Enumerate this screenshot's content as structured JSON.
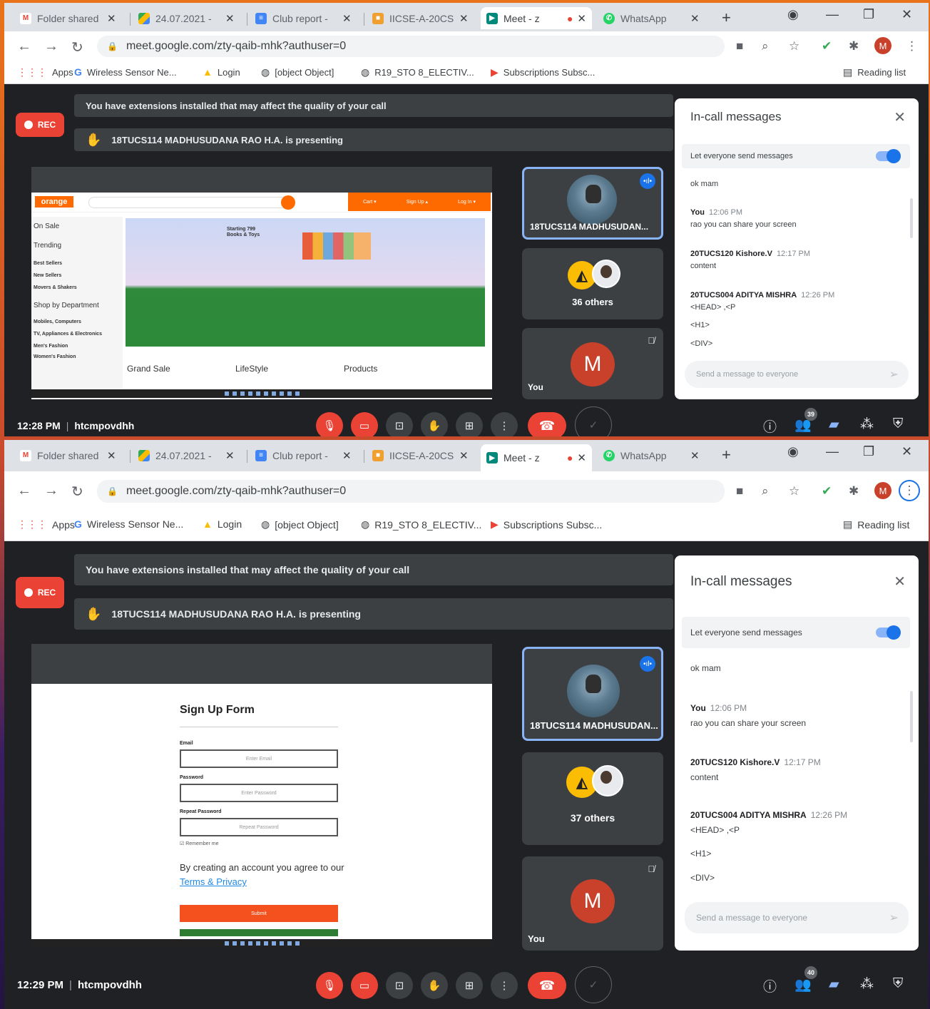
{
  "tabs": [
    {
      "label": "Folder shared",
      "icon": "gmail-icon"
    },
    {
      "label": "24.07.2021 -",
      "icon": "drive-icon"
    },
    {
      "label": "Club report -",
      "icon": "docs-icon"
    },
    {
      "label": "IICSE-A-20CS",
      "icon": "classroom-icon"
    },
    {
      "label": "Meet - z",
      "icon": "meet-icon"
    },
    {
      "label": "WhatsApp",
      "icon": "whatsapp-icon"
    }
  ],
  "url": "meet.google.com/zty-qaib-mhk?authuser=0",
  "bookmarks": [
    "Apps",
    "Wireless Sensor Ne...",
    "Login",
    "[object Object]",
    "R19_STO 8_ELECTIV...",
    "Subscriptions Subsc..."
  ],
  "reading_list": "Reading list",
  "profile_initial": "M",
  "meet": {
    "extension_warning": "You have extensions installed that may affect the quality of your call",
    "presenting": "18TUCS114 MADHUSUDANA RAO H.A. is presenting",
    "rec_label": "REC",
    "presenter_tile_name": "18TUCS114 MADHUSUDAN...",
    "you_label": "You",
    "you_initial": "M",
    "meeting_code": "htcmpovdhh"
  },
  "chat": {
    "title": "In-call messages",
    "toggle_label": "Let everyone send messages",
    "placeholder": "Send a message to everyone",
    "messages": [
      {
        "text": "ok mam"
      },
      {
        "sender": "You",
        "time": "12:06 PM",
        "text": "rao you can share your screen"
      },
      {
        "sender": "20TUCS120 Kishore.V",
        "time": "12:17 PM",
        "text": "content"
      },
      {
        "sender": "20TUCS004 ADITYA MISHRA",
        "time": "12:26 PM",
        "text": "<HEAD> ,<P"
      },
      {
        "text": "<H1>"
      },
      {
        "text": "<DIV>"
      }
    ]
  },
  "screen1": {
    "time": "12:28 PM",
    "others": "36 others",
    "participants": "39",
    "site": {
      "logo": "orange",
      "side_items": [
        "On Sale",
        "Trending",
        "Best Sellers",
        "New Sellers",
        "Movers & Shakers",
        "Shop by Department",
        "Mobiles, Computers",
        "TV, Appliances & Electronics",
        "Men's Fashion",
        "Women's Fashion"
      ],
      "banner_text": "Starting 799 Books & Toys",
      "categories": [
        "Grand Sale",
        "LifeStyle",
        "Products"
      ]
    }
  },
  "screen2": {
    "time": "12:29 PM",
    "others": "37 others",
    "participants": "40",
    "form": {
      "title": "Sign Up Form",
      "email_label": "Email",
      "email_placeholder": "Enter Email",
      "password_label": "Password",
      "password_placeholder": "Enter Password",
      "repeat_label": "Repeat Password",
      "repeat_placeholder": "Repeat Password",
      "remember": "Remember me",
      "agree_text": "By creating an account you agree to our",
      "terms_link": "Terms & Privacy",
      "submit": "Submit"
    }
  },
  "colors": {
    "accent": "#1a73e8",
    "rec": "#ea4335",
    "orange": "#ff6a00",
    "meet_bg": "#202124"
  }
}
